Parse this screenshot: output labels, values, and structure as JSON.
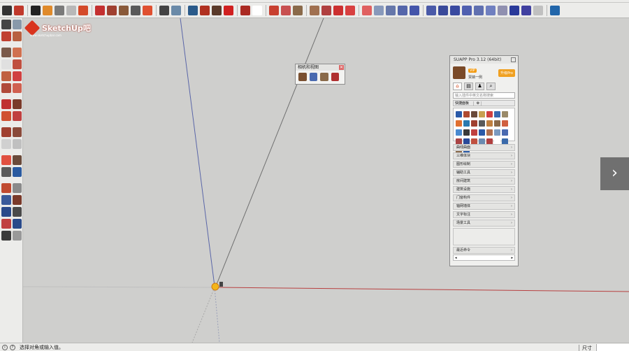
{
  "toolbar": {
    "colors": [
      "#333333",
      "#c0392b",
      "#222222",
      "#e08a2a",
      "#7a7a7a",
      "#b8b8b8",
      "#d44a2a",
      "#c43030",
      "#a04030",
      "#8a5a3a",
      "#5a5a5a",
      "#e05030",
      "#444444",
      "#6a8aa8",
      "#2a5a8a",
      "#b03020",
      "#5a3a2a",
      "#d02020",
      "#aa2a22",
      "#ffffff",
      "#c84030",
      "#c85050",
      "#8a6a4a",
      "#a07050",
      "#b04040",
      "#cc3030",
      "#d84040",
      "#e06060",
      "#8899bb",
      "#6677aa",
      "#5566aa",
      "#4455aa",
      "#4a5aa8",
      "#3a4a9a",
      "#3a4aa0",
      "#5060b0",
      "#6070b0",
      "#7080c0",
      "#9090b0",
      "#2a3a9a",
      "#4040a0",
      "#c0c0c0",
      "#2266aa"
    ]
  },
  "lefttb": {
    "colors": [
      "#444444",
      "#8899aa",
      "#c04030",
      "#b86040",
      "#7a5a4a",
      "#d07050",
      "#e0e0e0",
      "#c05040",
      "#c06040",
      "#d04040",
      "#b04a3a",
      "#d06050",
      "#c03030",
      "#7a3a2a",
      "#d05030",
      "#c04040",
      "#a04030",
      "#8a4a3a",
      "#d0d0d0",
      "#c0c0c0",
      "#e05040",
      "#6a4a3a",
      "#5a5a5a",
      "#2a5aa0",
      "#c04a30",
      "#8a8a8a",
      "#3a5a9a",
      "#7a3a2a",
      "#2a4a8a",
      "#4a4a4a",
      "#c04040",
      "#2a4a8a",
      "#3a3a3a",
      "#999999"
    ]
  },
  "logo": {
    "text": "SketchUp吧",
    "sub": "www.sketchupbar.com"
  },
  "float_toolbar": {
    "title": "相机和视图",
    "close": "✕",
    "icon_colors": [
      "#7a5030",
      "#4a6ab0",
      "#8a6a4a",
      "#b03030"
    ]
  },
  "suapp": {
    "title": "SUAPP Pro 3.12 (64bit)",
    "vip": "VIP",
    "username": "贾婧一例",
    "upgrade": "升级Pro",
    "tabs": [
      "⌂",
      "▤",
      "♟",
      "⌕"
    ],
    "search_placeholder": "输入插件中英文名称搜索",
    "quick_panel": "快捷面板",
    "gear": "⚙",
    "grid_colors": [
      "#2a5aa8",
      "#b04a30",
      "#6a4a3a",
      "#c8a050",
      "#d04040",
      "#3a6ab0",
      "#9a8a6a",
      "#e07030",
      "#2a7ab0",
      "#a04030",
      "#5a5a5a",
      "#c08040",
      "#8a6a4a",
      "#d06040",
      "#4a8ad0",
      "#3a3a3a",
      "#c04040",
      "#2a5aa8",
      "#b07050",
      "#7a9ac0",
      "#4a6ab0",
      "#aa4444",
      "#2a4a9a",
      "#c05040",
      "#6a8ab0",
      "#b04040",
      "#ffffff",
      "#3a6aaa",
      "#8a6a4a",
      "#2a5aa8"
    ],
    "categories": [
      "曲线曲面",
      "三维体块",
      "图形绘制",
      "辅助工具",
      "房间建筑",
      "建筑设施",
      "门窗构件",
      "轴网墙体",
      "文字标注",
      "场景工具"
    ],
    "recent": "最近命令",
    "arrow": "›",
    "scroll_left": "◂",
    "scroll_right": "▸"
  },
  "nav": {
    "next": "›"
  },
  "statusbar": {
    "icon1": "i",
    "icon2": "?",
    "hint": "选择对角或输入值。",
    "measure_label": "尺寸",
    "measure_value": ""
  }
}
